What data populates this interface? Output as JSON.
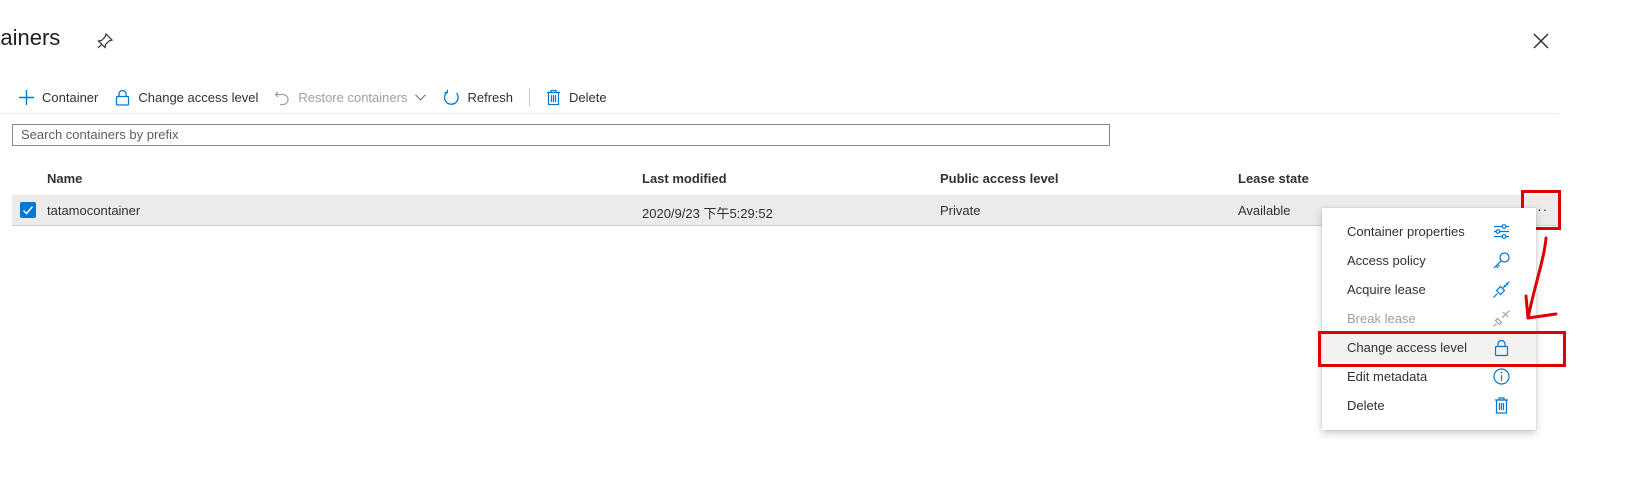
{
  "header": {
    "title": "ntainers",
    "pin_icon": "pin-icon",
    "close_icon": "close-icon"
  },
  "toolbar": {
    "add_container": "Container",
    "change_access_level": "Change access level",
    "restore_containers": "Restore containers",
    "refresh": "Refresh",
    "delete": "Delete"
  },
  "search": {
    "placeholder": "Search containers by prefix",
    "value": ""
  },
  "table": {
    "columns": [
      "Name",
      "Last modified",
      "Public access level",
      "Lease state"
    ],
    "rows": [
      {
        "selected": true,
        "name": "tatamocontainer",
        "last_modified": "2020/9/23 下午5:29:52",
        "public_access": "Private",
        "lease_state": "Available"
      }
    ]
  },
  "context_menu": {
    "items": [
      {
        "label": "Container properties",
        "icon": "sliders-icon",
        "enabled": true
      },
      {
        "label": "Access policy",
        "icon": "key-icon",
        "enabled": true
      },
      {
        "label": "Acquire lease",
        "icon": "plug-icon",
        "enabled": true
      },
      {
        "label": "Break lease",
        "icon": "unplug-icon",
        "enabled": false
      },
      {
        "label": "Change access level",
        "icon": "lock-icon",
        "enabled": true,
        "highlighted": true
      },
      {
        "label": "Edit metadata",
        "icon": "info-icon",
        "enabled": true
      },
      {
        "label": "Delete",
        "icon": "trash-icon",
        "enabled": true
      }
    ]
  },
  "colors": {
    "accent": "#0078d4",
    "annotation": "#e00000",
    "selected_row": "#edebe9"
  }
}
